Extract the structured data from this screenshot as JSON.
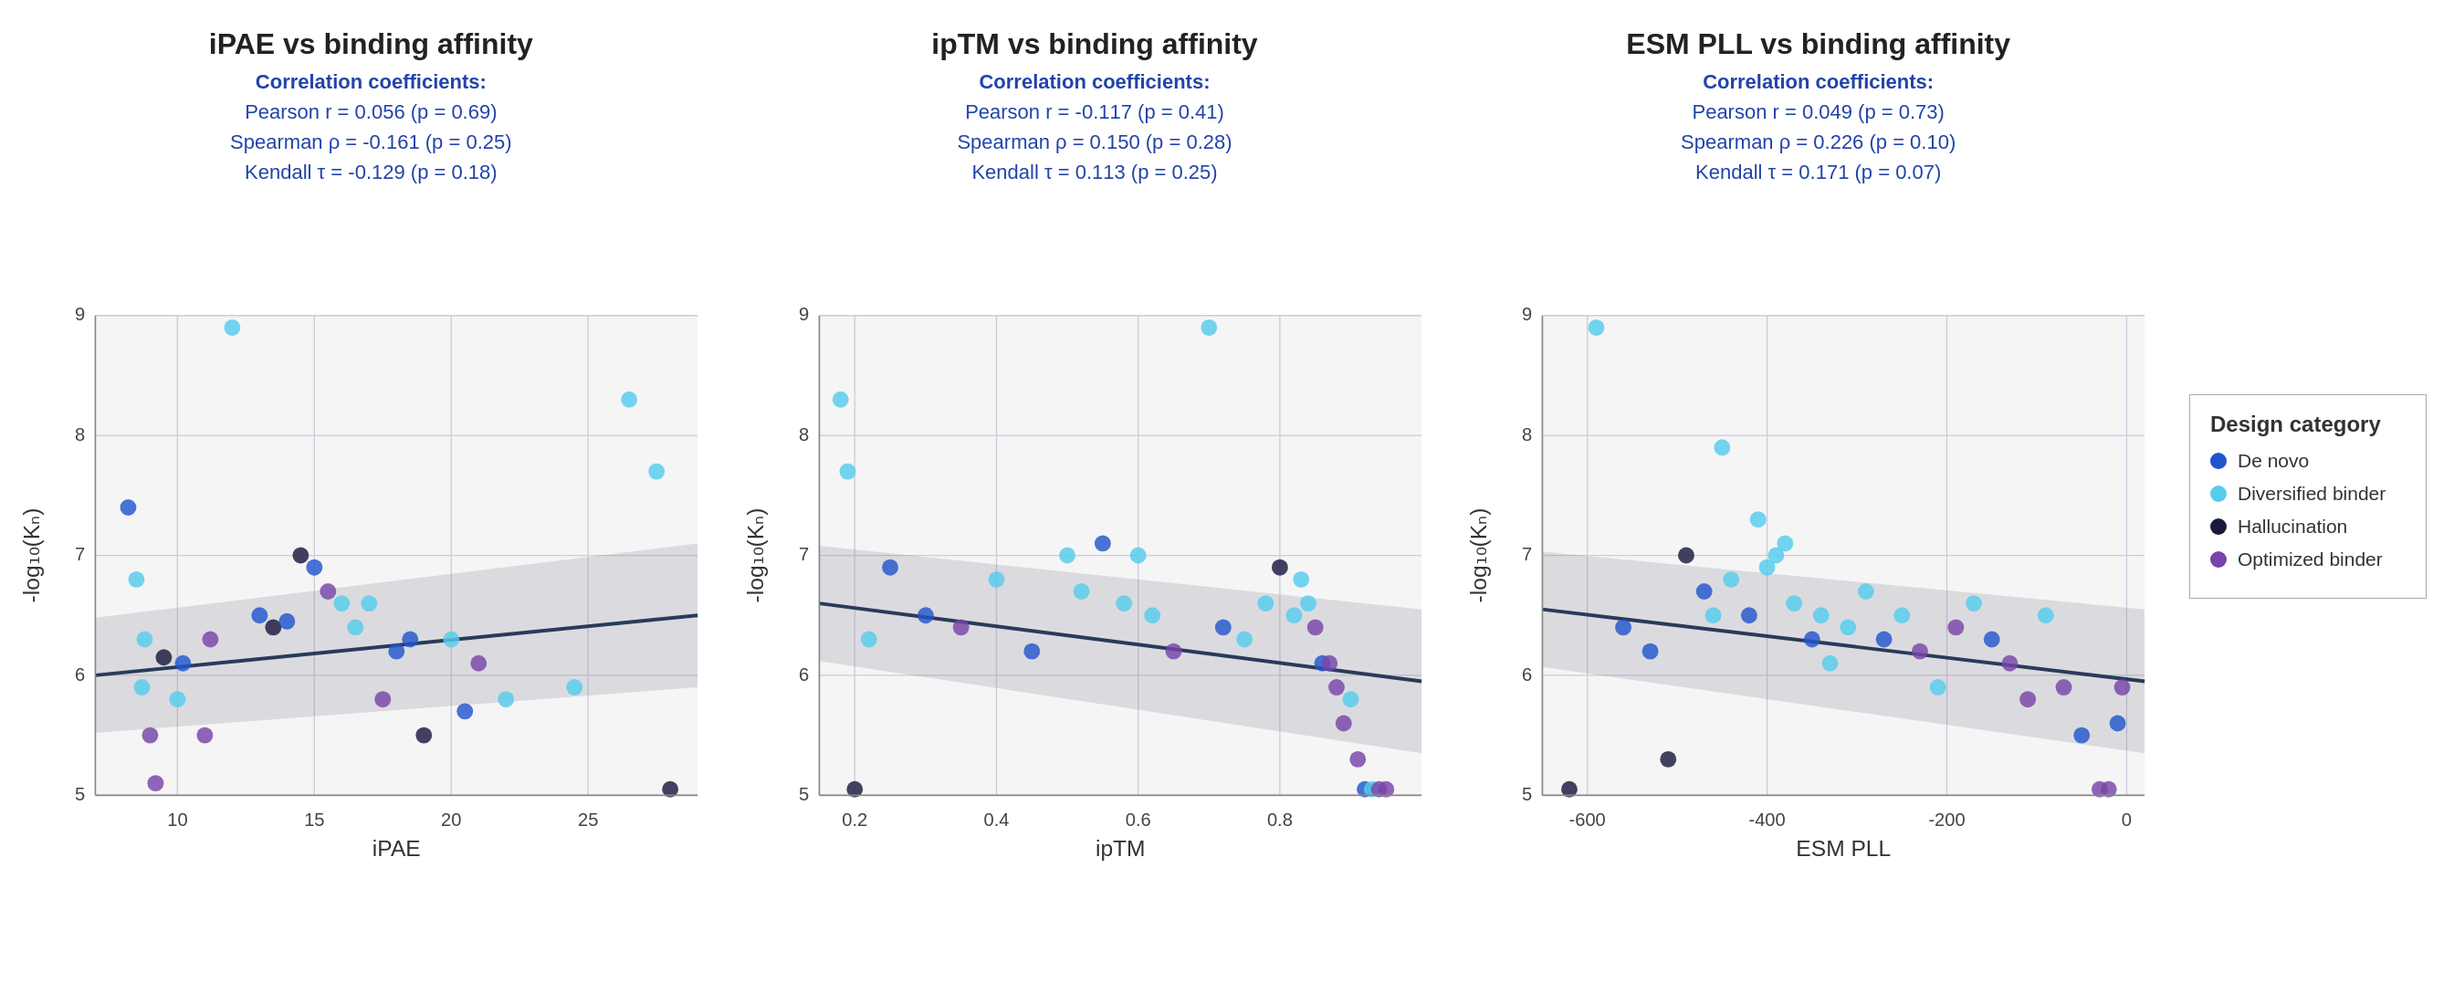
{
  "charts": [
    {
      "id": "ipae",
      "title": "iPAE vs binding affinity",
      "xlabel": "iPAE",
      "ylabel": "-log₁₀(Kₙ)",
      "corr_header": "Correlation coefficients:",
      "corr_lines": [
        "Pearson r = 0.056 (p = 0.69)",
        "Spearman ρ = -0.161 (p = 0.25)",
        "Kendall τ = -0.129 (p = 0.18)"
      ],
      "xmin": 7,
      "xmax": 29,
      "ymin": 5,
      "ymax": 9,
      "xticks": [
        10,
        15,
        20,
        25
      ],
      "yticks": [
        5,
        6,
        7,
        8,
        9
      ],
      "trend": {
        "x1": 7,
        "y1": 6.0,
        "x2": 29,
        "y2": 6.5
      },
      "points": [
        {
          "x": 8.2,
          "y": 7.4,
          "cat": "de_novo"
        },
        {
          "x": 8.5,
          "y": 6.8,
          "cat": "diversified"
        },
        {
          "x": 8.8,
          "y": 6.3,
          "cat": "diversified"
        },
        {
          "x": 8.7,
          "y": 5.9,
          "cat": "diversified"
        },
        {
          "x": 9.0,
          "y": 5.5,
          "cat": "optimized"
        },
        {
          "x": 9.2,
          "y": 5.1,
          "cat": "optimized"
        },
        {
          "x": 9.5,
          "y": 6.15,
          "cat": "hallucination"
        },
        {
          "x": 10.0,
          "y": 5.8,
          "cat": "diversified"
        },
        {
          "x": 10.2,
          "y": 6.1,
          "cat": "de_novo"
        },
        {
          "x": 11.0,
          "y": 5.5,
          "cat": "optimized"
        },
        {
          "x": 11.2,
          "y": 6.3,
          "cat": "optimized"
        },
        {
          "x": 12.0,
          "y": 8.9,
          "cat": "diversified"
        },
        {
          "x": 13.0,
          "y": 6.5,
          "cat": "de_novo"
        },
        {
          "x": 13.5,
          "y": 6.4,
          "cat": "hallucination"
        },
        {
          "x": 14.0,
          "y": 6.45,
          "cat": "de_novo"
        },
        {
          "x": 14.5,
          "y": 7.0,
          "cat": "hallucination"
        },
        {
          "x": 15.0,
          "y": 6.9,
          "cat": "de_novo"
        },
        {
          "x": 15.5,
          "y": 6.7,
          "cat": "optimized"
        },
        {
          "x": 16.0,
          "y": 6.6,
          "cat": "diversified"
        },
        {
          "x": 16.5,
          "y": 6.4,
          "cat": "diversified"
        },
        {
          "x": 17.0,
          "y": 6.6,
          "cat": "diversified"
        },
        {
          "x": 17.5,
          "y": 5.8,
          "cat": "optimized"
        },
        {
          "x": 18.0,
          "y": 6.2,
          "cat": "de_novo"
        },
        {
          "x": 18.5,
          "y": 6.3,
          "cat": "de_novo"
        },
        {
          "x": 19.0,
          "y": 5.5,
          "cat": "hallucination"
        },
        {
          "x": 20.0,
          "y": 6.3,
          "cat": "diversified"
        },
        {
          "x": 20.5,
          "y": 5.7,
          "cat": "de_novo"
        },
        {
          "x": 21.0,
          "y": 6.1,
          "cat": "optimized"
        },
        {
          "x": 22.0,
          "y": 5.8,
          "cat": "diversified"
        },
        {
          "x": 24.5,
          "y": 5.9,
          "cat": "diversified"
        },
        {
          "x": 26.5,
          "y": 8.3,
          "cat": "diversified"
        },
        {
          "x": 27.5,
          "y": 7.7,
          "cat": "diversified"
        },
        {
          "x": 28.0,
          "y": 5.05,
          "cat": "hallucination"
        }
      ]
    },
    {
      "id": "iptm",
      "title": "ipTM vs binding affinity",
      "xlabel": "ipTM",
      "ylabel": "-log₁₀(Kₙ)",
      "corr_header": "Correlation coefficients:",
      "corr_lines": [
        "Pearson r = -0.117 (p = 0.41)",
        "Spearman ρ = 0.150 (p = 0.28)",
        "Kendall τ = 0.113 (p = 0.25)"
      ],
      "xmin": 0.15,
      "xmax": 1.0,
      "ymin": 5,
      "ymax": 9,
      "xticks": [
        0.2,
        0.4,
        0.6,
        0.8
      ],
      "yticks": [
        5,
        6,
        7,
        8,
        9
      ],
      "trend": {
        "x1": 0.15,
        "y1": 6.6,
        "x2": 1.0,
        "y2": 5.95
      },
      "points": [
        {
          "x": 0.18,
          "y": 8.3,
          "cat": "diversified"
        },
        {
          "x": 0.19,
          "y": 7.7,
          "cat": "diversified"
        },
        {
          "x": 0.2,
          "y": 5.05,
          "cat": "hallucination"
        },
        {
          "x": 0.22,
          "y": 6.3,
          "cat": "diversified"
        },
        {
          "x": 0.25,
          "y": 6.9,
          "cat": "de_novo"
        },
        {
          "x": 0.3,
          "y": 6.5,
          "cat": "de_novo"
        },
        {
          "x": 0.35,
          "y": 6.4,
          "cat": "optimized"
        },
        {
          "x": 0.4,
          "y": 6.8,
          "cat": "diversified"
        },
        {
          "x": 0.45,
          "y": 6.2,
          "cat": "de_novo"
        },
        {
          "x": 0.5,
          "y": 7.0,
          "cat": "diversified"
        },
        {
          "x": 0.52,
          "y": 6.7,
          "cat": "diversified"
        },
        {
          "x": 0.55,
          "y": 7.1,
          "cat": "de_novo"
        },
        {
          "x": 0.58,
          "y": 6.6,
          "cat": "diversified"
        },
        {
          "x": 0.6,
          "y": 7.0,
          "cat": "diversified"
        },
        {
          "x": 0.62,
          "y": 6.5,
          "cat": "diversified"
        },
        {
          "x": 0.65,
          "y": 6.2,
          "cat": "optimized"
        },
        {
          "x": 0.7,
          "y": 8.9,
          "cat": "diversified"
        },
        {
          "x": 0.72,
          "y": 6.4,
          "cat": "de_novo"
        },
        {
          "x": 0.75,
          "y": 6.3,
          "cat": "diversified"
        },
        {
          "x": 0.78,
          "y": 6.6,
          "cat": "diversified"
        },
        {
          "x": 0.8,
          "y": 6.9,
          "cat": "hallucination"
        },
        {
          "x": 0.82,
          "y": 6.5,
          "cat": "diversified"
        },
        {
          "x": 0.83,
          "y": 6.8,
          "cat": "diversified"
        },
        {
          "x": 0.84,
          "y": 6.6,
          "cat": "diversified"
        },
        {
          "x": 0.85,
          "y": 6.4,
          "cat": "optimized"
        },
        {
          "x": 0.86,
          "y": 6.1,
          "cat": "de_novo"
        },
        {
          "x": 0.87,
          "y": 6.1,
          "cat": "optimized"
        },
        {
          "x": 0.88,
          "y": 5.9,
          "cat": "optimized"
        },
        {
          "x": 0.89,
          "y": 5.6,
          "cat": "optimized"
        },
        {
          "x": 0.9,
          "y": 5.8,
          "cat": "diversified"
        },
        {
          "x": 0.91,
          "y": 5.3,
          "cat": "optimized"
        },
        {
          "x": 0.92,
          "y": 5.05,
          "cat": "de_novo"
        },
        {
          "x": 0.93,
          "y": 5.05,
          "cat": "diversified"
        },
        {
          "x": 0.94,
          "y": 5.05,
          "cat": "optimized"
        },
        {
          "x": 0.95,
          "y": 5.05,
          "cat": "optimized"
        }
      ]
    },
    {
      "id": "esmpll",
      "title": "ESM PLL vs binding affinity",
      "xlabel": "ESM PLL",
      "ylabel": "-log₁₀(Kₙ)",
      "corr_header": "Correlation coefficients:",
      "corr_lines": [
        "Pearson r = 0.049 (p = 0.73)",
        "Spearman ρ = 0.226 (p = 0.10)",
        "Kendall τ = 0.171 (p = 0.07)"
      ],
      "xmin": -650,
      "xmax": 20,
      "ymin": 5,
      "ymax": 9,
      "xticks": [
        -600,
        -400,
        -200,
        0
      ],
      "yticks": [
        5,
        6,
        7,
        8,
        9
      ],
      "trend": {
        "x1": -650,
        "y1": 6.55,
        "x2": 20,
        "y2": 5.95
      },
      "points": [
        {
          "x": -620,
          "y": 5.05,
          "cat": "hallucination"
        },
        {
          "x": -590,
          "y": 8.9,
          "cat": "diversified"
        },
        {
          "x": -560,
          "y": 6.4,
          "cat": "de_novo"
        },
        {
          "x": -530,
          "y": 6.2,
          "cat": "de_novo"
        },
        {
          "x": -510,
          "y": 5.3,
          "cat": "hallucination"
        },
        {
          "x": -490,
          "y": 7.0,
          "cat": "hallucination"
        },
        {
          "x": -470,
          "y": 6.7,
          "cat": "de_novo"
        },
        {
          "x": -460,
          "y": 6.5,
          "cat": "diversified"
        },
        {
          "x": -450,
          "y": 7.9,
          "cat": "diversified"
        },
        {
          "x": -440,
          "y": 6.8,
          "cat": "diversified"
        },
        {
          "x": -420,
          "y": 6.5,
          "cat": "de_novo"
        },
        {
          "x": -410,
          "y": 7.3,
          "cat": "diversified"
        },
        {
          "x": -400,
          "y": 6.9,
          "cat": "diversified"
        },
        {
          "x": -390,
          "y": 7.0,
          "cat": "diversified"
        },
        {
          "x": -380,
          "y": 7.1,
          "cat": "diversified"
        },
        {
          "x": -370,
          "y": 6.6,
          "cat": "diversified"
        },
        {
          "x": -350,
          "y": 6.3,
          "cat": "de_novo"
        },
        {
          "x": -340,
          "y": 6.5,
          "cat": "diversified"
        },
        {
          "x": -330,
          "y": 6.1,
          "cat": "diversified"
        },
        {
          "x": -310,
          "y": 6.4,
          "cat": "diversified"
        },
        {
          "x": -290,
          "y": 6.7,
          "cat": "diversified"
        },
        {
          "x": -270,
          "y": 6.3,
          "cat": "de_novo"
        },
        {
          "x": -250,
          "y": 6.5,
          "cat": "diversified"
        },
        {
          "x": -230,
          "y": 6.2,
          "cat": "optimized"
        },
        {
          "x": -210,
          "y": 5.9,
          "cat": "diversified"
        },
        {
          "x": -190,
          "y": 6.4,
          "cat": "optimized"
        },
        {
          "x": -170,
          "y": 6.6,
          "cat": "diversified"
        },
        {
          "x": -150,
          "y": 6.3,
          "cat": "de_novo"
        },
        {
          "x": -130,
          "y": 6.1,
          "cat": "optimized"
        },
        {
          "x": -110,
          "y": 5.8,
          "cat": "optimized"
        },
        {
          "x": -90,
          "y": 6.5,
          "cat": "diversified"
        },
        {
          "x": -70,
          "y": 5.9,
          "cat": "optimized"
        },
        {
          "x": -50,
          "y": 5.5,
          "cat": "de_novo"
        },
        {
          "x": -30,
          "y": 5.05,
          "cat": "optimized"
        },
        {
          "x": -20,
          "y": 5.05,
          "cat": "optimized"
        },
        {
          "x": -10,
          "y": 5.6,
          "cat": "de_novo"
        },
        {
          "x": -5,
          "y": 5.9,
          "cat": "optimized"
        }
      ]
    }
  ],
  "legend": {
    "title": "Design category",
    "items": [
      {
        "label": "De novo",
        "color": "#2255cc",
        "id": "de_novo"
      },
      {
        "label": "Diversified binder",
        "color": "#55ccee",
        "id": "diversified"
      },
      {
        "label": "Hallucination",
        "color": "#1a1a3e",
        "id": "hallucination"
      },
      {
        "label": "Optimized binder",
        "color": "#7744aa",
        "id": "optimized"
      }
    ]
  }
}
